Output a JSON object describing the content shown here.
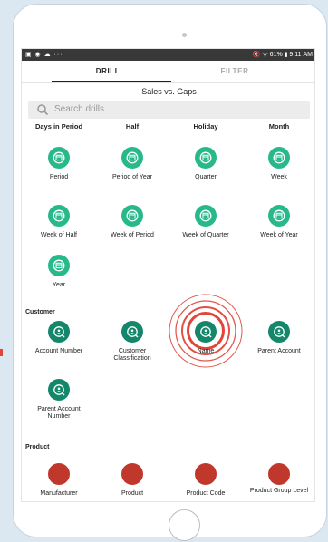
{
  "status": {
    "left_icons": "▣ ◉ ☁ ···",
    "right": "🔇 ᯤ 61% ▮ 9:11 AM"
  },
  "tabs": {
    "drill": "DRILL",
    "filter": "FILTER"
  },
  "page": {
    "subtitle": "Sales vs. Gaps"
  },
  "search": {
    "placeholder": "Search drills"
  },
  "time_headers": [
    "Days in Period",
    "Half",
    "Holiday",
    "Month"
  ],
  "time_items": [
    "Period",
    "Period of Year",
    "Quarter",
    "Week",
    "Week of Half",
    "Week of Period",
    "Week of Quarter",
    "Week of Year",
    "Year"
  ],
  "customer": {
    "title": "Customer",
    "items": [
      "Account Number",
      "Customer Classification",
      "Name",
      "Parent Account",
      "Parent Account Number"
    ]
  },
  "product": {
    "title": "Product",
    "items": [
      "Manufacturer",
      "Product",
      "Product Code",
      "Product Group Level"
    ]
  },
  "colors": {
    "time": "#27b98a",
    "customer": "#14866a",
    "product": "#c0372c",
    "ripple": "#e0463a"
  },
  "icons": {
    "time": "calendar-icon",
    "customer": "person-search-icon"
  }
}
